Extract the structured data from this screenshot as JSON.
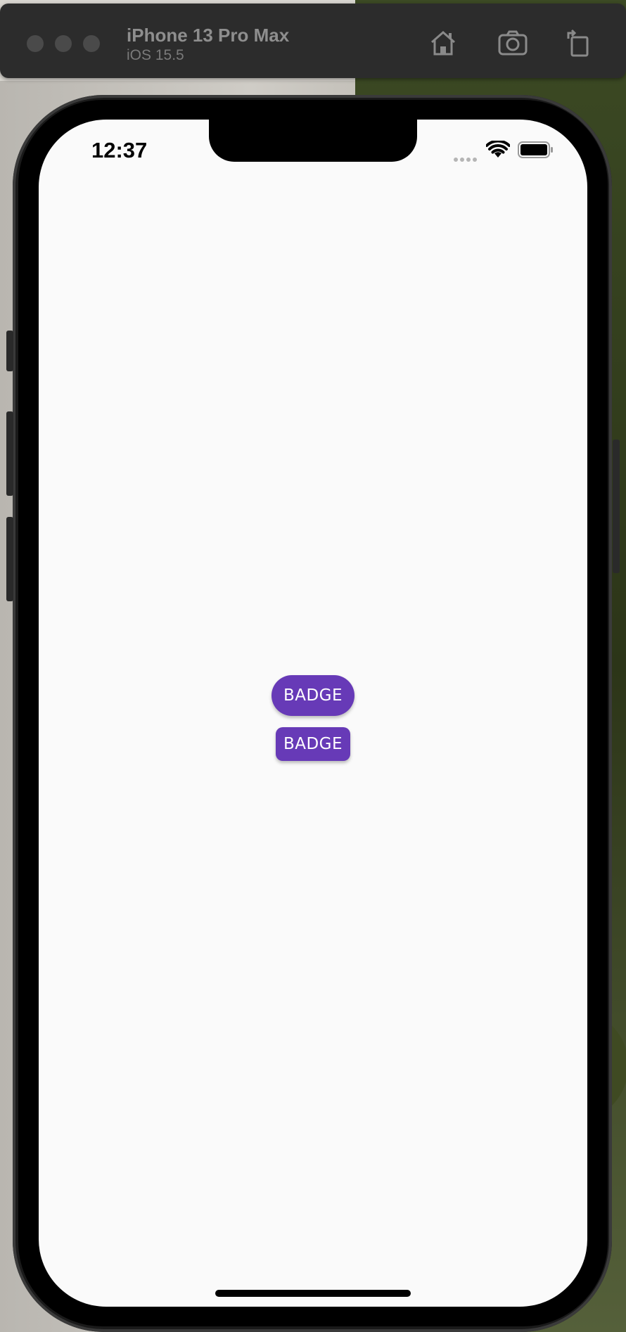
{
  "simulator": {
    "device_name": "iPhone 13 Pro Max",
    "os_version": "iOS 15.5",
    "toolbar_icons": [
      "home-icon",
      "screenshot-camera-icon",
      "rotate-icon"
    ]
  },
  "status_bar": {
    "time": "12:37",
    "icons": [
      "cellular-dots-icon",
      "wifi-icon",
      "battery-icon"
    ]
  },
  "content": {
    "badges": [
      {
        "label": "BADGE",
        "shape": "pill"
      },
      {
        "label": "BADGE",
        "shape": "rounded-rectangle"
      }
    ]
  },
  "colors": {
    "badge_background": "#673ab7",
    "badge_text": "#ffffff",
    "screen_background": "#fafafa"
  }
}
